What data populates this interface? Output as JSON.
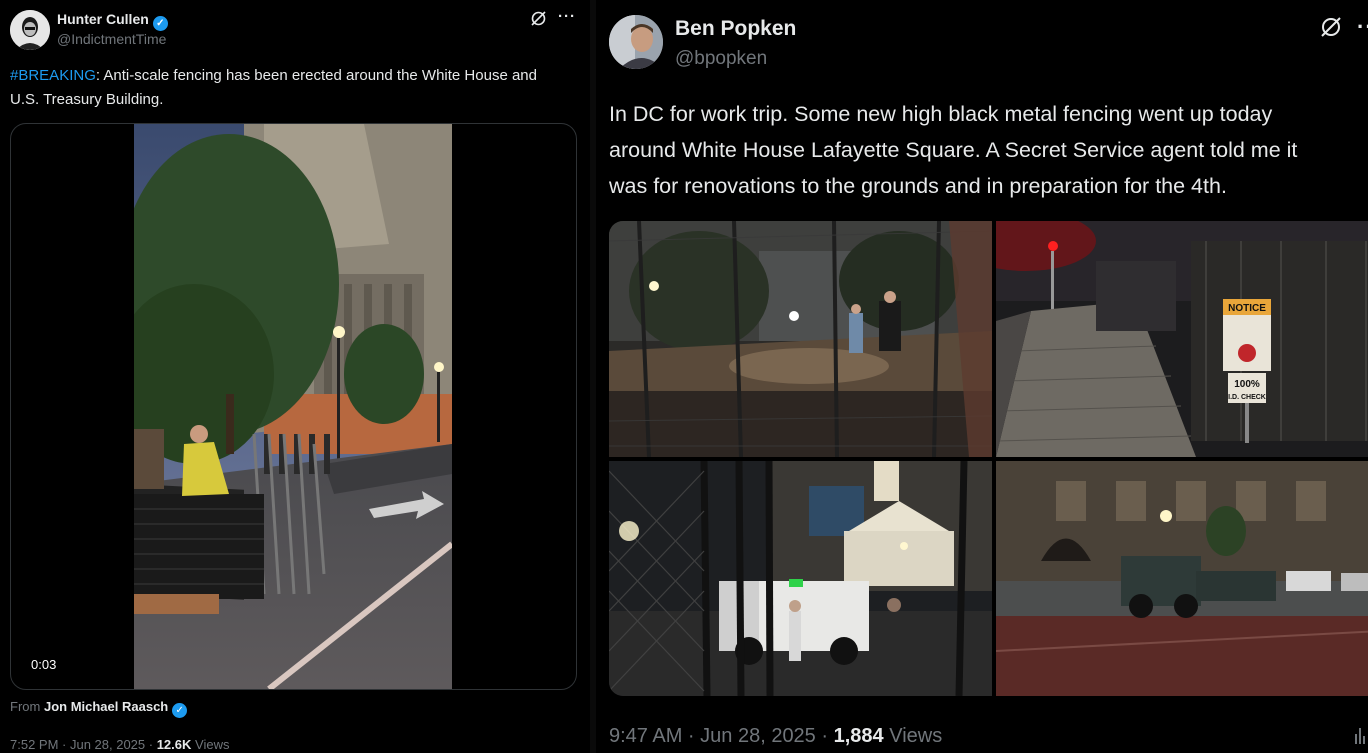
{
  "left_tweet": {
    "author_name": "Hunter Cullen",
    "author_handle": "@IndictmentTime",
    "hashtag": "#BREAKING",
    "text": ": Anti-scale fencing has been erected around the White House and U.S. Treasury Building.",
    "video_duration": "0:03",
    "from_prefix": "From",
    "from_name": "Jon Michael Raasch",
    "time_date": "7:52 PM · Jun 28, 2025 · ",
    "views_count": "12.6K",
    "views_label": " Views"
  },
  "right_tweet": {
    "author_name": "Ben Popken",
    "author_handle": "@bpopken",
    "text_lines": [
      "In DC for work trip. Some new high black metal fencing went up today",
      "around White House Lafayette Square. A Secret Service agent told me it",
      "was for renovations to the grounds and in preparation for the 4th."
    ],
    "photo_sign_text": [
      "NOTICE",
      "100%",
      "I.D. CHECK"
    ],
    "time_date": "9:47 AM · Jun 28, 2025 · ",
    "views_count": "1,884",
    "views_label": " Views"
  },
  "icons": {
    "verified": "verified-badge-icon",
    "grok": "grok-icon",
    "more": "more-icon",
    "stats": "stats-icon"
  },
  "colors": {
    "background": "#000000",
    "text": "#e7e9ea",
    "secondary": "#71767b",
    "accent": "#1d9bf0",
    "border": "#2f3336"
  }
}
